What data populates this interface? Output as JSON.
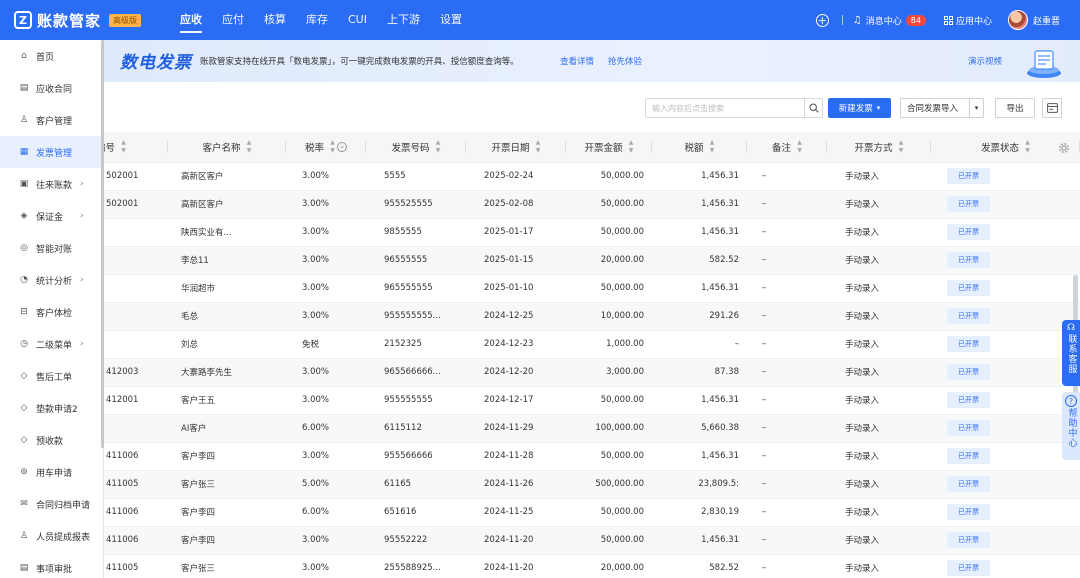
{
  "app": {
    "logo_mark": "Z",
    "name": "账款管家",
    "badge": "高级版"
  },
  "topnav": [
    "应收",
    "应付",
    "核算",
    "库存",
    "CUI",
    "上下游",
    "设置"
  ],
  "top_right": {
    "messages_label": "消息中心",
    "messages_count": "84",
    "app_center_label": "应用中心",
    "user_name": "赵重晋"
  },
  "sidebar": {
    "items": [
      {
        "label": "首页",
        "icon": "⌂",
        "chevron": false
      },
      {
        "label": "应收合同",
        "icon": "▤",
        "chevron": false
      },
      {
        "label": "客户管理",
        "icon": "♙",
        "chevron": false
      },
      {
        "label": "发票管理",
        "icon": "▦",
        "chevron": false
      },
      {
        "label": "往来账款",
        "icon": "▣",
        "chevron": true
      },
      {
        "label": "保证金",
        "icon": "◈",
        "chevron": true
      },
      {
        "label": "智能对账",
        "icon": "◎",
        "chevron": false
      },
      {
        "label": "统计分析",
        "icon": "◔",
        "chevron": true
      },
      {
        "label": "客户体检",
        "icon": "⊟",
        "chevron": false
      },
      {
        "label": "二级菜单",
        "icon": "◷",
        "chevron": true
      },
      {
        "label": "售后工单",
        "icon": "◇",
        "chevron": false
      },
      {
        "label": "垫款申请2",
        "icon": "◇",
        "chevron": false
      },
      {
        "label": "预收款",
        "icon": "◇",
        "chevron": false
      },
      {
        "label": "用车申请",
        "icon": "⊚",
        "chevron": false
      },
      {
        "label": "合同归档申请",
        "icon": "✉",
        "chevron": false
      },
      {
        "label": "人员提成报表",
        "icon": "♙",
        "chevron": false
      },
      {
        "label": "事项审批",
        "icon": "▤",
        "chevron": false
      }
    ],
    "active_index": 3
  },
  "banner": {
    "title": "数电发票",
    "text": "账款管家支持在线开具「数电发票」，可一键完成数电发票的开具、授信额度查询等。",
    "link_details": "查看详情",
    "link_trial": "抢先体验",
    "demo_video": "演示视频"
  },
  "toolbar": {
    "search_placeholder": "输入内容后点击搜索",
    "new_invoice": "新建发票",
    "import_contract_invoice": "合同发票导入",
    "export": "导出"
  },
  "table": {
    "columns": [
      "编号",
      "客户名称",
      "税率",
      "发票号码",
      "开票日期",
      "开票金额",
      "税额",
      "备注",
      "开票方式",
      "发票状态"
    ],
    "rows": [
      [
        "502001",
        "高新区客户",
        "3.00%",
        "5555",
        "2025-02-24",
        "50,000.00",
        "1,456.31",
        "–",
        "手动录入",
        "已开票"
      ],
      [
        "502001",
        "高新区客户",
        "3.00%",
        "955525555",
        "2025-02-08",
        "50,000.00",
        "1,456.31",
        "–",
        "手动录入",
        "已开票"
      ],
      [
        "",
        "陕西实业有...",
        "3.00%",
        "9855555",
        "2025-01-17",
        "50,000.00",
        "1,456.31",
        "–",
        "手动录入",
        "已开票"
      ],
      [
        "",
        "李总11",
        "3.00%",
        "96555555",
        "2025-01-15",
        "20,000.00",
        "582.52",
        "–",
        "手动录入",
        "已开票"
      ],
      [
        "",
        "华润超市",
        "3.00%",
        "965555555",
        "2025-01-10",
        "50,000.00",
        "1,456.31",
        "–",
        "手动录入",
        "已开票"
      ],
      [
        "",
        "毛总",
        "3.00%",
        "955555555...",
        "2024-12-25",
        "10,000.00",
        "291.26",
        "–",
        "手动录入",
        "已开票"
      ],
      [
        "",
        "刘总",
        "免税",
        "2152325",
        "2024-12-23",
        "1,000.00",
        "–",
        "–",
        "手动录入",
        "已开票"
      ],
      [
        "412003",
        "大寨路李先生",
        "3.00%",
        "965566666...",
        "2024-12-20",
        "3,000.00",
        "87.38",
        "–",
        "手动录入",
        "已开票"
      ],
      [
        "412001",
        "客户王五",
        "3.00%",
        "955555555",
        "2024-12-17",
        "50,000.00",
        "1,456.31",
        "–",
        "手动录入",
        "已开票"
      ],
      [
        "",
        "AI客户",
        "6.00%",
        "6115112",
        "2024-11-29",
        "100,000.00",
        "5,660.38",
        "–",
        "手动录入",
        "已开票"
      ],
      [
        "411006",
        "客户李四",
        "3.00%",
        "955566666",
        "2024-11-28",
        "50,000.00",
        "1,456.31",
        "–",
        "手动录入",
        "已开票"
      ],
      [
        "411005",
        "客户张三",
        "5.00%",
        "61165",
        "2024-11-26",
        "500,000.00",
        "23,809.5:",
        "–",
        "手动录入",
        "已开票"
      ],
      [
        "411006",
        "客户李四",
        "6.00%",
        "651616",
        "2024-11-25",
        "50,000.00",
        "2,830.19",
        "–",
        "手动录入",
        "已开票"
      ],
      [
        "411006",
        "客户李四",
        "3.00%",
        "95552222",
        "2024-11-20",
        "50,000.00",
        "1,456.31",
        "–",
        "手动录入",
        "已开票"
      ],
      [
        "411005",
        "客户张三",
        "3.00%",
        "255588925...",
        "2024-11-20",
        "20,000.00",
        "582.52",
        "–",
        "手动录入",
        "已开票"
      ]
    ]
  },
  "float": {
    "service": "联系客服",
    "help": "帮助中心"
  }
}
